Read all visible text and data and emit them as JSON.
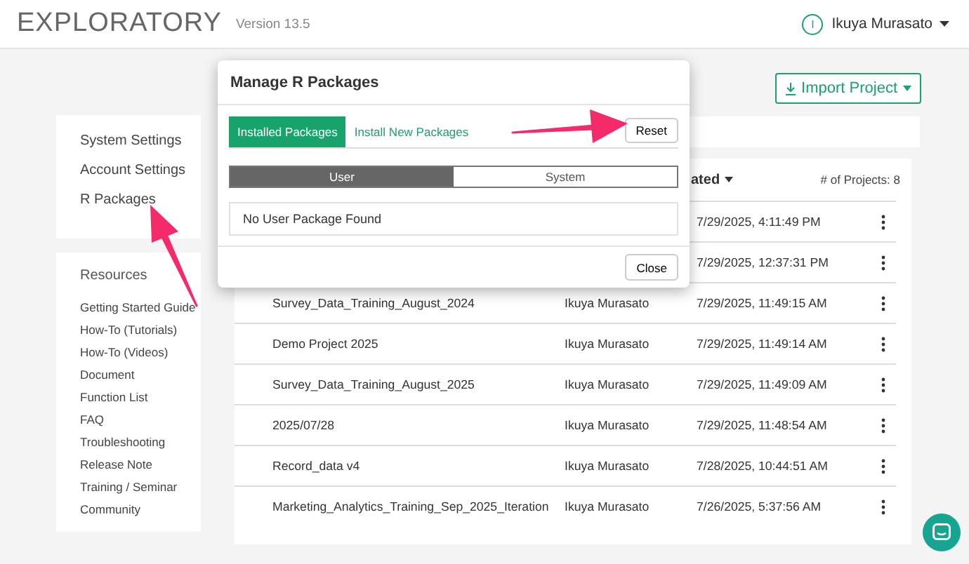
{
  "header": {
    "logo": "EXPLORATORY",
    "version": "Version 13.5",
    "avatar_initial": "I",
    "user_name": "Ikuya Murasato"
  },
  "import_button": {
    "label": "Import Project"
  },
  "sidebar": {
    "settings": [
      "System Settings",
      "Account Settings",
      "R Packages"
    ],
    "resources_title": "Resources",
    "resources": [
      "Getting Started Guide",
      "How-To (Tutorials)",
      "How-To (Videos)",
      "Document",
      "Function List",
      "FAQ",
      "Troubleshooting",
      "Release Note",
      "Training / Seminar",
      "Community"
    ]
  },
  "table": {
    "column_3": "ated",
    "project_count": "# of Projects: 8",
    "rows": [
      {
        "updated": "7/29/2025, 4:11:49 PM"
      },
      {
        "updated": "7/29/2025, 12:37:31 PM"
      },
      {
        "name": "Survey_Data_Training_August_2024",
        "owner": "Ikuya Murasato",
        "updated": "7/29/2025, 11:49:15 AM"
      },
      {
        "name": "Demo Project 2025",
        "owner": "Ikuya Murasato",
        "updated": "7/29/2025, 11:49:14 AM"
      },
      {
        "name": "Survey_Data_Training_August_2025",
        "owner": "Ikuya Murasato",
        "updated": "7/29/2025, 11:49:09 AM"
      },
      {
        "name": "2025/07/28",
        "owner": "Ikuya Murasato",
        "updated": "7/29/2025, 11:48:54 AM"
      },
      {
        "name": "Record_data v4",
        "owner": "Ikuya Murasato",
        "updated": "7/28/2025, 10:44:51 AM"
      },
      {
        "name": "Marketing_Analytics_Training_Sep_2025_Iteration",
        "owner": "Ikuya Murasato",
        "updated": "7/26/2025, 5:37:56 AM"
      }
    ]
  },
  "modal": {
    "title": "Manage R Packages",
    "tabs": [
      {
        "label": "Installed Packages",
        "selected": true
      },
      {
        "label": "Install New Packages",
        "selected": false
      }
    ],
    "reset_button": "Reset",
    "scope": [
      {
        "label": "User",
        "selected": true
      },
      {
        "label": "System",
        "selected": false
      }
    ],
    "message": "No User Package Found",
    "close_button": "Close"
  }
}
